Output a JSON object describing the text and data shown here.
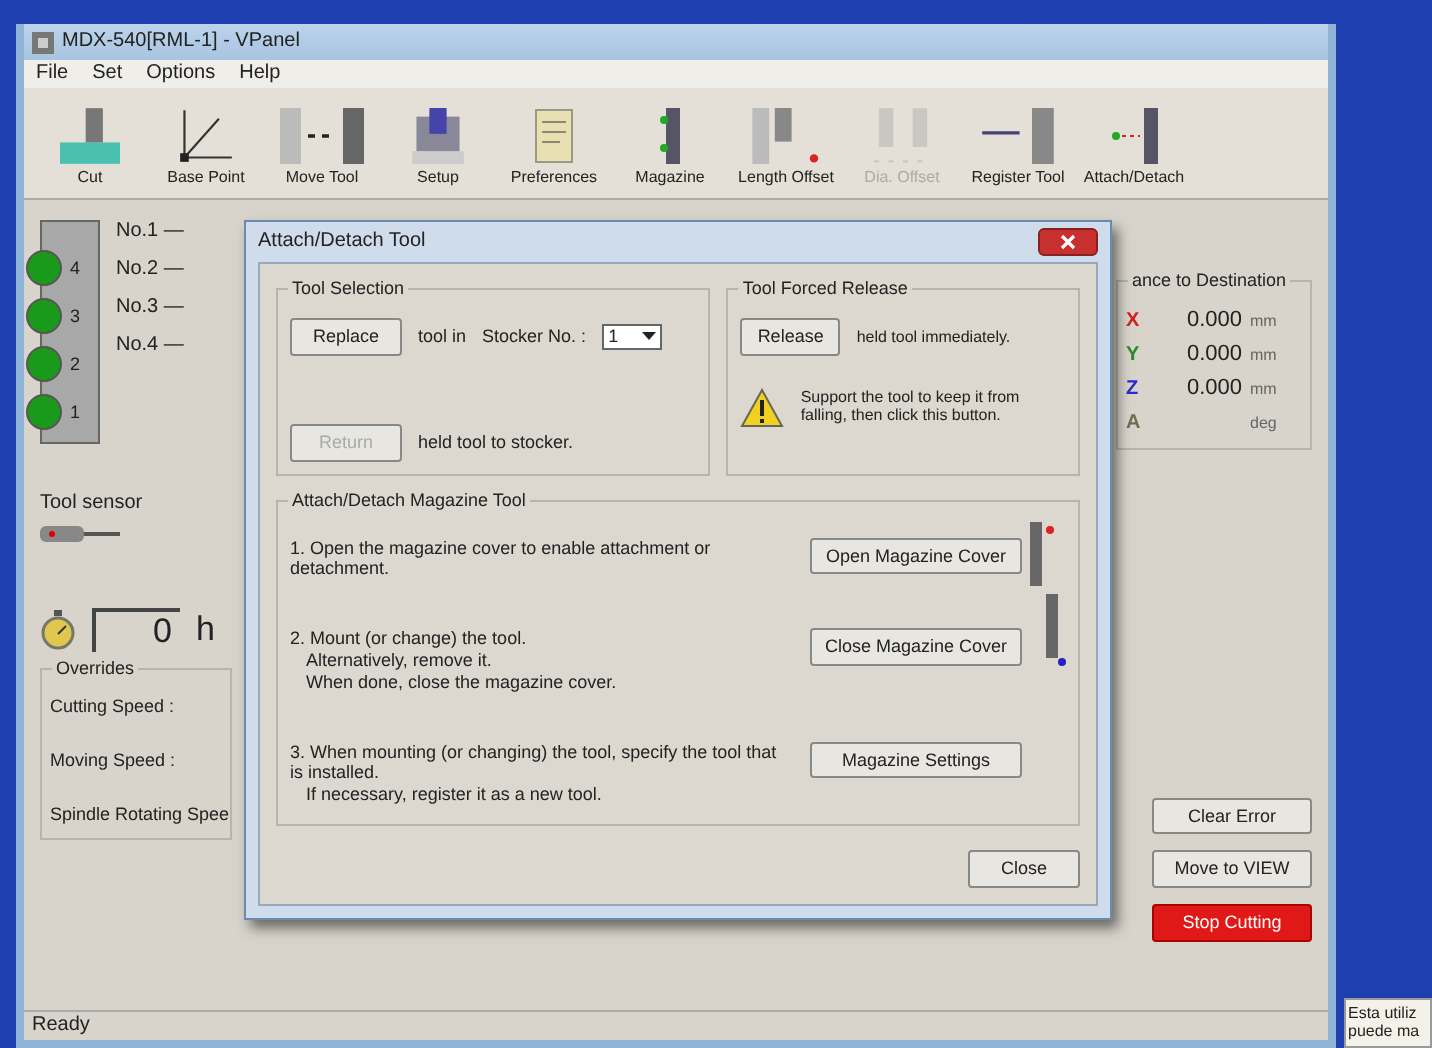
{
  "window": {
    "title": "MDX-540[RML-1] - VPanel"
  },
  "menu": [
    "File",
    "Set",
    "Options",
    "Help"
  ],
  "toolbar": [
    {
      "label": "Cut",
      "disabled": false
    },
    {
      "label": "Base Point",
      "disabled": false
    },
    {
      "label": "Move Tool",
      "disabled": false
    },
    {
      "label": "Setup",
      "disabled": false
    },
    {
      "label": "Preferences",
      "disabled": false
    },
    {
      "label": "Magazine",
      "disabled": false
    },
    {
      "label": "Length Offset",
      "disabled": false
    },
    {
      "label": "Dia. Offset",
      "disabled": true
    },
    {
      "label": "Register Tool",
      "disabled": false
    },
    {
      "label": "Attach/Detach",
      "disabled": false
    }
  ],
  "stocker": {
    "slots": [
      {
        "number": "4",
        "occupied": true
      },
      {
        "number": "3",
        "occupied": true
      },
      {
        "number": "2",
        "occupied": true
      },
      {
        "number": "1",
        "occupied": true
      }
    ],
    "tools": [
      "No.1 —",
      "No.2 —",
      "No.3 —",
      "No.4 —"
    ]
  },
  "tool_sensor": {
    "label": "Tool sensor"
  },
  "timer": {
    "value": "0",
    "unit": "h"
  },
  "overrides": {
    "title": "Overrides",
    "items": [
      "Cutting Speed :",
      "Moving Speed :",
      "Spindle Rotating Spee"
    ]
  },
  "destination": {
    "title": "ance to Destination",
    "axes": [
      {
        "axis": "X",
        "value": "0.000",
        "unit": "mm",
        "color": "#d42020"
      },
      {
        "axis": "Y",
        "value": "0.000",
        "unit": "mm",
        "color": "#2a8a2a"
      },
      {
        "axis": "Z",
        "value": "0.000",
        "unit": "mm",
        "color": "#2a2ad0"
      },
      {
        "axis": "A",
        "unit": "deg",
        "color": "#707050"
      }
    ]
  },
  "right_buttons": [
    {
      "label": "Clear Error",
      "kind": "normal"
    },
    {
      "label": "Move to VIEW",
      "kind": "normal"
    },
    {
      "label": "Stop Cutting",
      "kind": "danger"
    }
  ],
  "status_bar": "Ready",
  "notification": [
    "Esta utiliz",
    "puede ma"
  ],
  "dialog": {
    "title": "Attach/Detach Tool",
    "tool_selection": {
      "title": "Tool Selection",
      "replace_button": "Replace",
      "tool_in": "tool in",
      "stocker_label": "Stocker No. :",
      "stocker_value": "1",
      "return_button": {
        "label": "Return",
        "disabled": true
      },
      "return_text": "held tool to stocker."
    },
    "forced_release": {
      "title": "Tool Forced Release",
      "release_button": "Release",
      "release_text": "held tool immediately.",
      "warning": "Support the tool to keep it from falling, then click this button."
    },
    "magazine": {
      "title": "Attach/Detach Magazine Tool",
      "steps": [
        {
          "lines": [
            "1. Open the magazine cover to enable attachment or detachment."
          ],
          "button": "Open Magazine Cover"
        },
        {
          "lines": [
            "2. Mount (or change) the tool.",
            "Alternatively, remove it.",
            "When done, close the magazine cover."
          ],
          "button": "Close Magazine Cover"
        },
        {
          "lines": [
            "3. When mounting (or changing) the tool, specify the tool that is installed.",
            "If necessary, register it as a new tool."
          ],
          "button": "Magazine Settings"
        }
      ]
    },
    "close_button": "Close"
  }
}
